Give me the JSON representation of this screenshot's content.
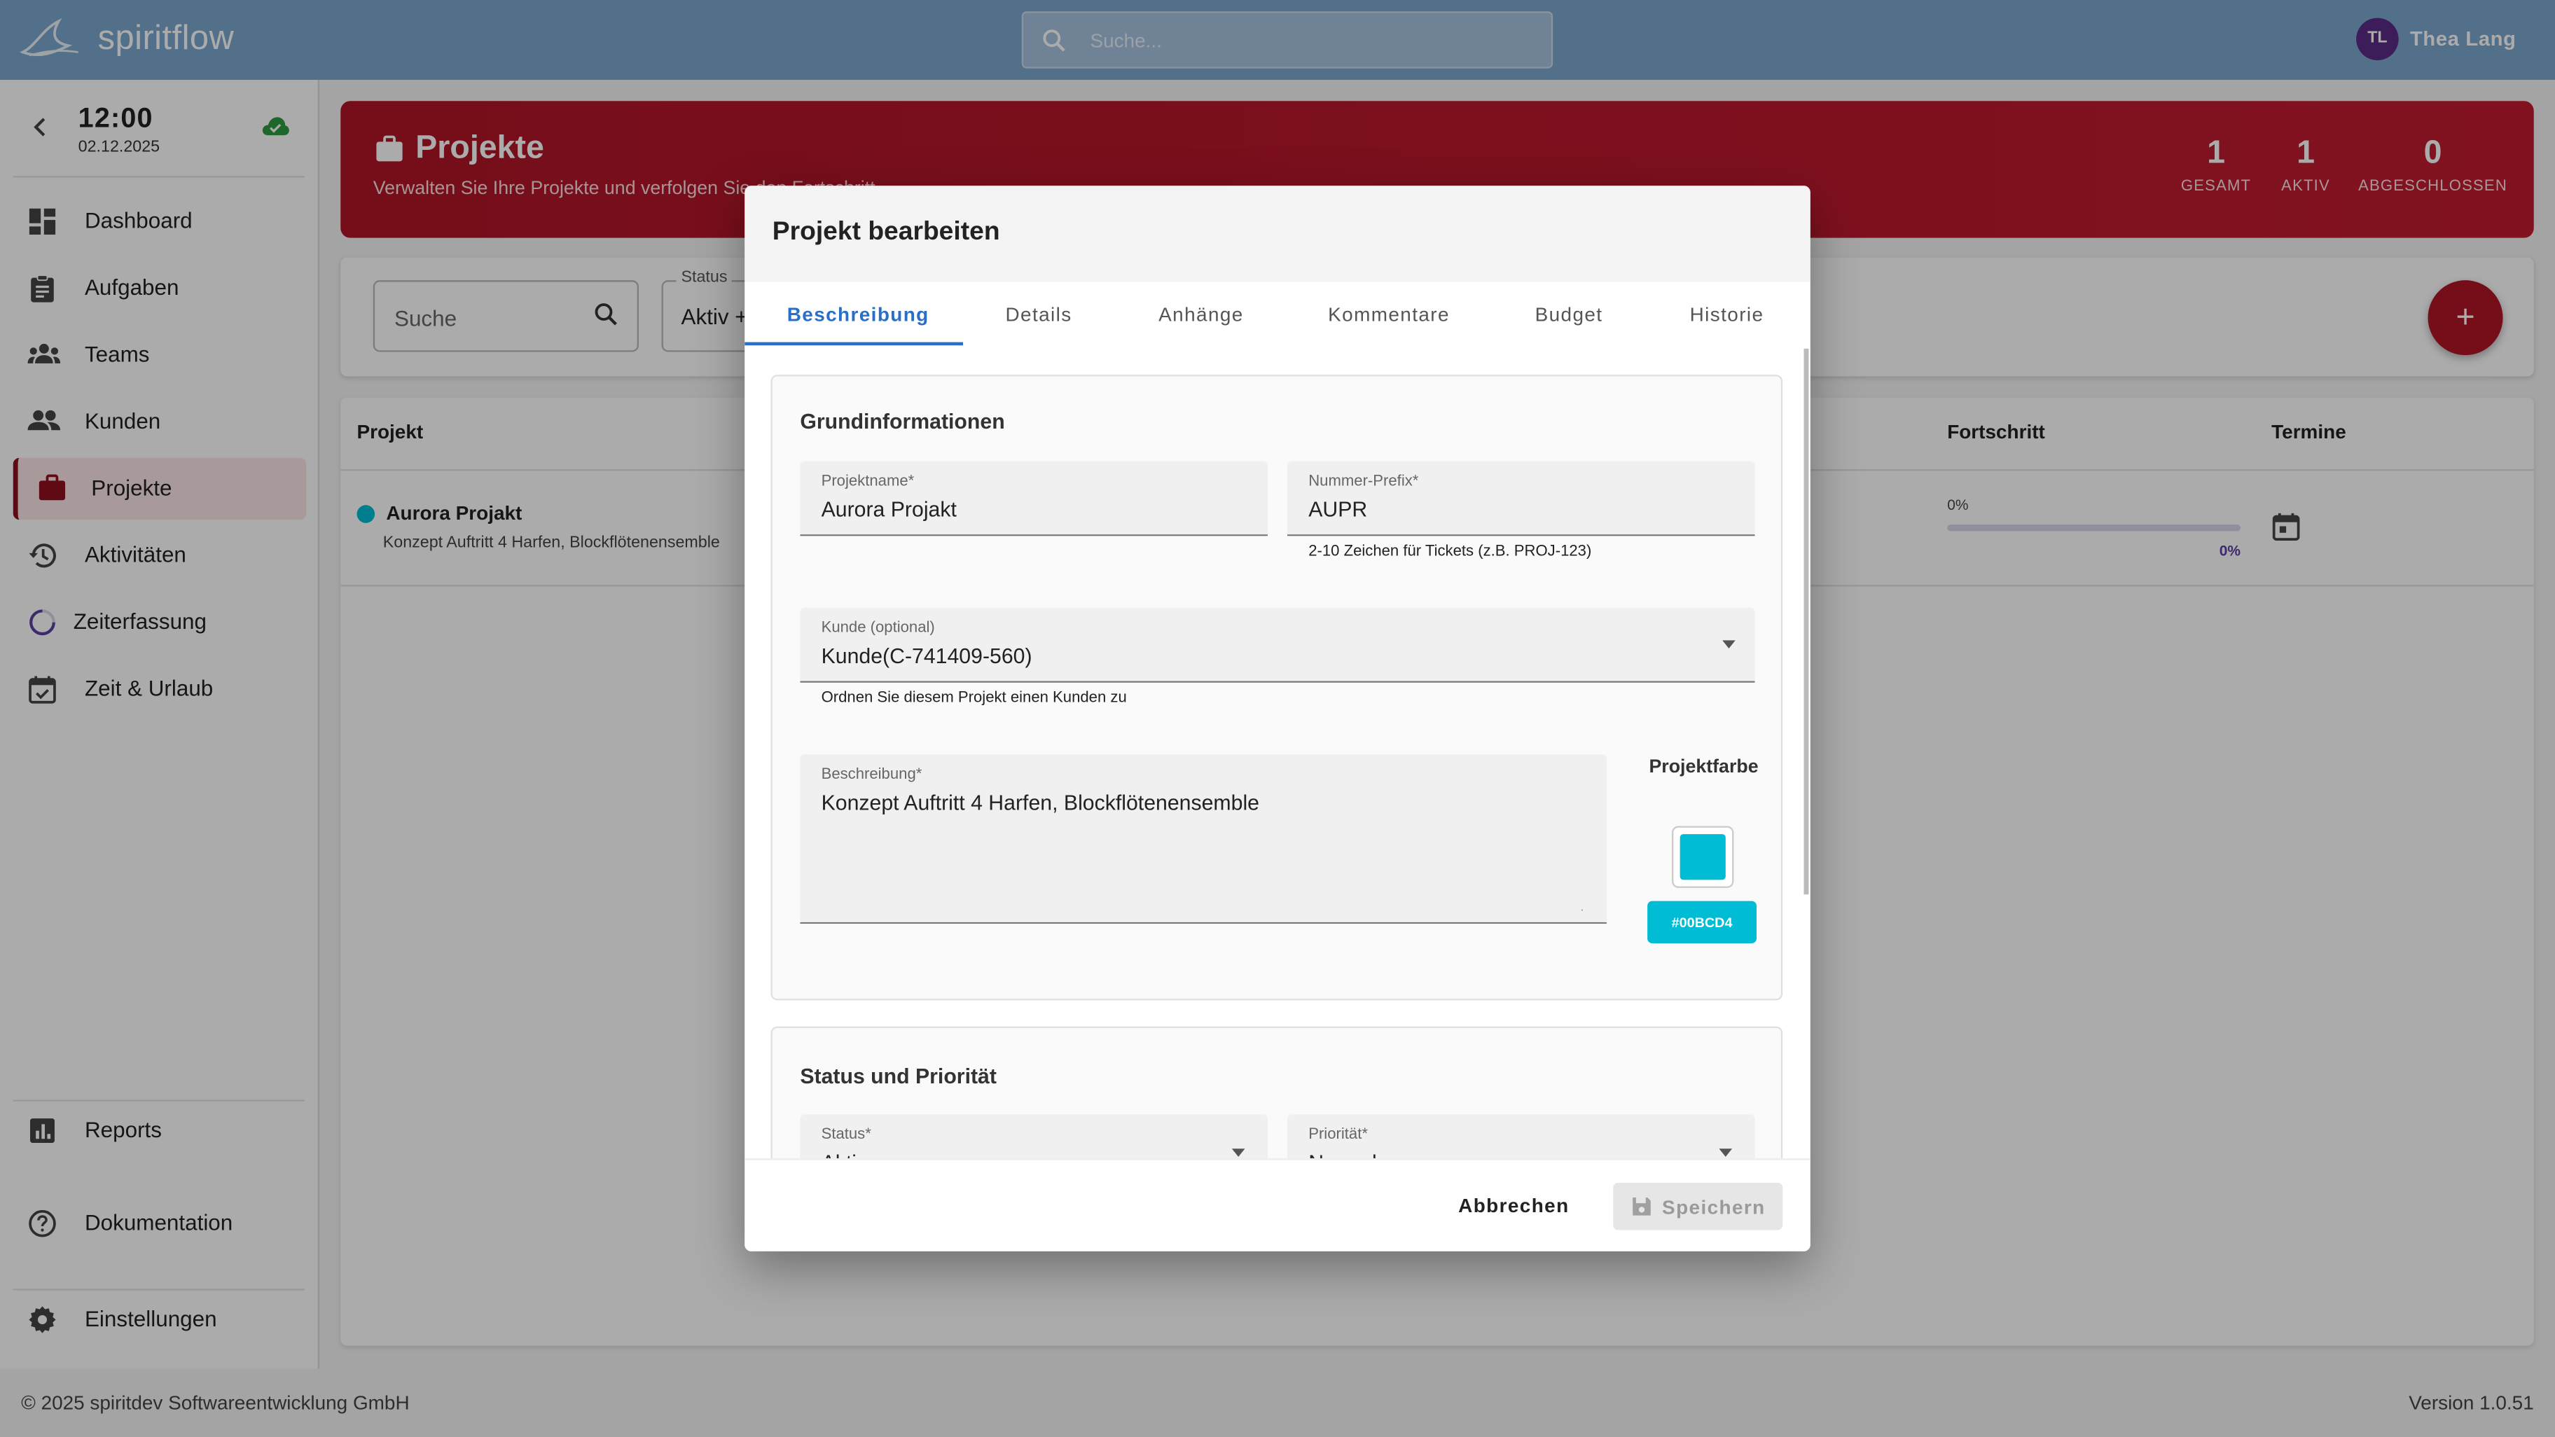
{
  "app": {
    "name": "spiritflow"
  },
  "header": {
    "search_placeholder": "Suche...",
    "user_initials": "TL",
    "user_name": "Thea Lang"
  },
  "sidebar": {
    "time": "12:00",
    "date": "02.12.2025",
    "items": [
      {
        "label": "Dashboard",
        "icon": "dashboard-icon"
      },
      {
        "label": "Aufgaben",
        "icon": "clipboard-icon"
      },
      {
        "label": "Teams",
        "icon": "groups-icon"
      },
      {
        "label": "Kunden",
        "icon": "people-icon"
      },
      {
        "label": "Projekte",
        "icon": "briefcase-icon",
        "active": true
      },
      {
        "label": "Aktivitäten",
        "icon": "history-icon"
      },
      {
        "label": "Zeiterfassung",
        "icon": "progress-circle-icon"
      },
      {
        "label": "Zeit & Urlaub",
        "icon": "calendar-check-icon"
      }
    ],
    "bottom_items": [
      {
        "label": "Reports",
        "icon": "chart-icon"
      },
      {
        "label": "Dokumentation",
        "icon": "help-icon"
      },
      {
        "label": "Einstellungen",
        "icon": "gear-icon"
      }
    ]
  },
  "banner": {
    "title": "Projekte",
    "subtitle": "Verwalten Sie Ihre Projekte und verfolgen Sie den Fortschritt",
    "stats": [
      {
        "value": "1",
        "label": "GESAMT"
      },
      {
        "value": "1",
        "label": "AKTIV"
      },
      {
        "value": "0",
        "label": "ABGESCHLOSSEN"
      }
    ]
  },
  "filters": {
    "search_label": "Suche",
    "status_label": "Status",
    "status_value": "Aktiv +"
  },
  "table": {
    "columns": [
      "Projekt",
      "Fortschritt",
      "Termine"
    ],
    "rows": [
      {
        "name": "Aurora Projakt",
        "description": "Konzept Auftritt 4 Harfen, Blockflötenensemble",
        "progress_label": "0%",
        "progress_value": 0,
        "color": "#00BCD4"
      }
    ]
  },
  "dialog": {
    "title": "Projekt bearbeiten",
    "tabs": [
      "Beschreibung",
      "Details",
      "Anhänge",
      "Kommentare",
      "Budget",
      "Historie"
    ],
    "active_tab": "Beschreibung",
    "basic_info": {
      "title": "Grundinformationen",
      "name_label": "Projektname*",
      "name_value": "Aurora Projakt",
      "prefix_label": "Nummer-Prefix*",
      "prefix_value": "AUPR",
      "prefix_helper": "2-10 Zeichen für Tickets (z.B. PROJ-123)",
      "customer_label": "Kunde (optional)",
      "customer_value": "Kunde(C-741409-560)",
      "customer_helper": "Ordnen Sie diesem Projekt einen Kunden zu",
      "description_label": "Beschreibung*",
      "description_value": "Konzept Auftritt 4 Harfen, Blockflötenensemble",
      "color_label": "Projektfarbe",
      "color_hex": "#00BCD4"
    },
    "status_priority": {
      "title": "Status und Priorität",
      "status_label": "Status*",
      "status_value": "Aktiv",
      "priority_label": "Priorität*",
      "priority_value": "Normal"
    },
    "cancel_label": "Abbrechen",
    "save_label": "Speichern"
  },
  "footer": {
    "copyright": "© 2025 spiritdev Softwareentwicklung GmbH",
    "version": "Version 1.0.51"
  }
}
